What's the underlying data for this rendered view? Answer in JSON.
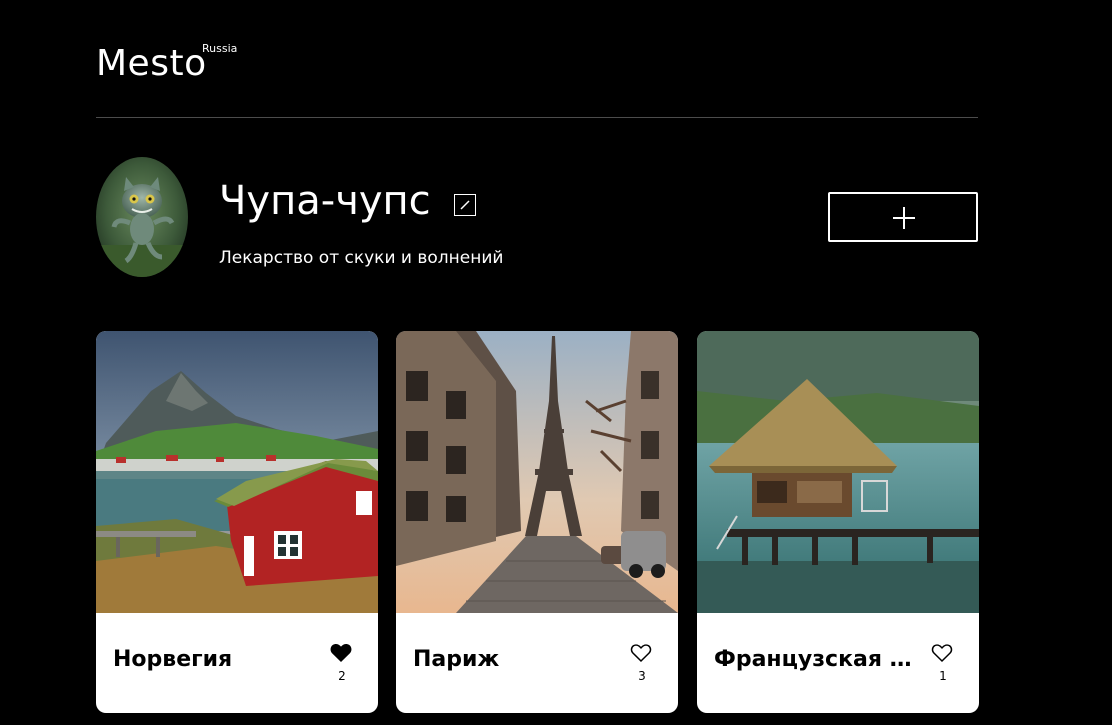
{
  "header": {
    "logo": "Mesto",
    "logo_sup": "Russia"
  },
  "profile": {
    "name": "Чупа-чупс",
    "about": "Лекарство от скуки и волнений"
  },
  "cards": [
    {
      "title": "Норвегия",
      "likes": "2",
      "liked": true,
      "image": "norway-landscape"
    },
    {
      "title": "Париж",
      "likes": "3",
      "liked": false,
      "image": "paris-eiffel-tower"
    },
    {
      "title": "Французская Полинезия",
      "likes": "1",
      "liked": false,
      "image": "overwater-bungalow"
    }
  ],
  "colors": {
    "background": "#000000",
    "card": "#ffffff",
    "divider": "#545454",
    "text_dark": "#000000",
    "text_light": "#ffffff"
  },
  "icons": {
    "edit": "pencil-icon",
    "add": "plus-icon",
    "like_filled": "heart-filled-icon",
    "like_empty": "heart-outline-icon"
  }
}
